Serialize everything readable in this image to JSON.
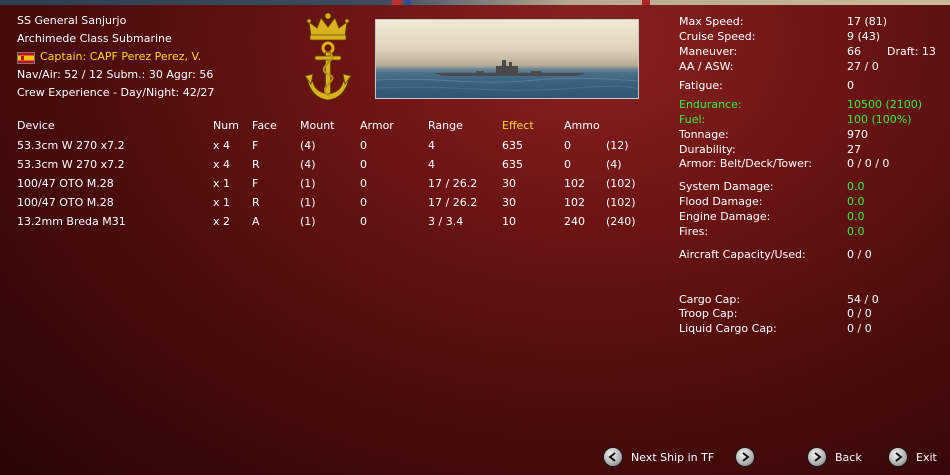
{
  "ship": {
    "name": "SS General Sanjurjo",
    "class": "Archimede Class Submarine",
    "captain": "Captain: CAPF Perez Perez, V.",
    "nav_line": "Nav/Air: 52 / 12  Subm.: 30  Aggr: 56",
    "crew_line": "Crew Experience - Day/Night: 42/27"
  },
  "weapons": {
    "headers": [
      "Device",
      "Num",
      "Face",
      "Mount",
      "Armor",
      "Range",
      "Effect",
      "Ammo",
      ""
    ],
    "rows": [
      [
        "53.3cm W 270 x7.2",
        "x 4",
        "F",
        "(4)",
        "0",
        "4",
        "635",
        "0",
        "(12)"
      ],
      [
        "53.3cm W 270 x7.2",
        "x 4",
        "R",
        "(4)",
        "0",
        "4",
        "635",
        "0",
        "(4)"
      ],
      [
        "100/47 OTO M.28",
        "x 1",
        "F",
        "(1)",
        "0",
        "17 / 26.2",
        "30",
        "102",
        "(102)"
      ],
      [
        "100/47 OTO M.28",
        "x 1",
        "R",
        "(1)",
        "0",
        "17 / 26.2",
        "30",
        "102",
        "(102)"
      ],
      [
        "13.2mm Breda M31",
        "x 2",
        "A",
        "(1)",
        "0",
        "3 / 3.4",
        "10",
        "240",
        "(240)"
      ]
    ]
  },
  "stats": {
    "max_speed": {
      "label": "Max Speed:",
      "value": "17 (81)"
    },
    "cruise_speed": {
      "label": "Cruise Speed:",
      "value": "9 (43)"
    },
    "maneuver": {
      "label": "Maneuver:",
      "value": "66",
      "draft": "Draft: 13"
    },
    "aa_asw": {
      "label": "AA / ASW:",
      "value": "27 / 0"
    },
    "fatigue": {
      "label": "Fatigue:",
      "value": "0"
    },
    "endurance": {
      "label": "Endurance:",
      "value": "10500 (2100)"
    },
    "fuel": {
      "label": "Fuel:",
      "value": "100 (100%)"
    },
    "tonnage": {
      "label": "Tonnage:",
      "value": "970"
    },
    "durability": {
      "label": "Durability:",
      "value": "27"
    },
    "armor": {
      "label": "Armor: Belt/Deck/Tower:",
      "value": "0 / 0 / 0"
    },
    "system_damage": {
      "label": "System Damage:",
      "value": "0.0"
    },
    "flood_damage": {
      "label": "Flood Damage:",
      "value": "0.0"
    },
    "engine_damage": {
      "label": "Engine Damage:",
      "value": "0.0"
    },
    "fires": {
      "label": "Fires:",
      "value": "0.0"
    },
    "aircraft": {
      "label": "Aircraft Capacity/Used:",
      "value": "0 / 0"
    },
    "cargo": {
      "label": "Cargo Cap:",
      "value": "54 / 0"
    },
    "troop": {
      "label": "Troop Cap:",
      "value": "0 / 0"
    },
    "liquid": {
      "label": "Liquid Cargo Cap:",
      "value": "0 / 0"
    }
  },
  "nav": {
    "next_ship": "Next Ship in TF",
    "back": "Back",
    "exit": "Exit"
  },
  "colors": {
    "highlight_yellow": "#ffd633",
    "highlight_green": "#33ee44",
    "background": "#6e1515"
  },
  "icons": [
    "spanish-flag-icon",
    "naval-anchor-crown-emblem",
    "arrow-left-icon",
    "arrow-right-icon"
  ]
}
